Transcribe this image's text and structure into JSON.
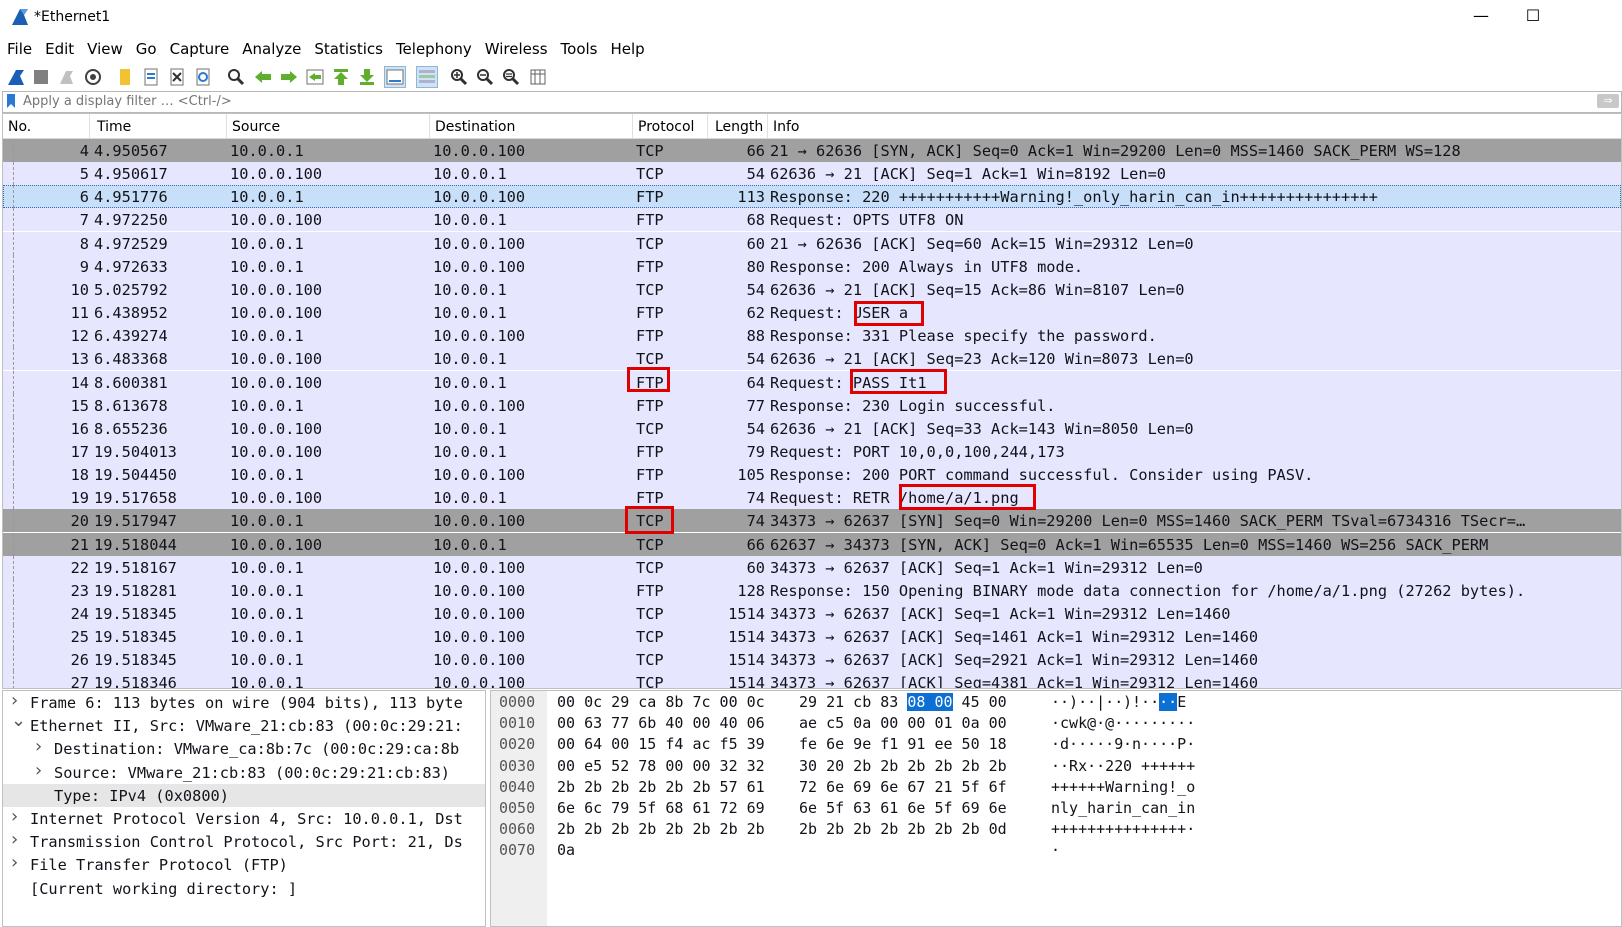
{
  "window": {
    "title": "*Ethernet1",
    "minimize": "—",
    "maximize": "☐"
  },
  "menu": [
    "File",
    "Edit",
    "View",
    "Go",
    "Capture",
    "Analyze",
    "Statistics",
    "Telephony",
    "Wireless",
    "Tools",
    "Help"
  ],
  "filter": {
    "placeholder": "Apply a display filter … <Ctrl-/>",
    "value": ""
  },
  "columns": [
    "No.",
    "Time",
    "Source",
    "Destination",
    "Protocol",
    "Length",
    "Info"
  ],
  "colors": {
    "tcp_row": "#e7e6ff",
    "selected_row": "#c7dff8",
    "dark_row": "#a0a0a0",
    "highlight": "#e00000"
  },
  "packets": [
    {
      "no": "4",
      "time": "4.950567",
      "src": "10.0.0.1",
      "dst": "10.0.0.100",
      "proto": "TCP",
      "len": "66",
      "info": "21 → 62636 [SYN, ACK] Seq=0 Ack=1 Win=29200 Len=0 MSS=1460 SACK_PERM WS=128",
      "style": "dark"
    },
    {
      "no": "5",
      "time": "4.950617",
      "src": "10.0.0.100",
      "dst": "10.0.0.1",
      "proto": "TCP",
      "len": "54",
      "info": "62636 → 21 [ACK] Seq=1 Ack=1 Win=8192 Len=0",
      "style": "tcp"
    },
    {
      "no": "6",
      "time": "4.951776",
      "src": "10.0.0.1",
      "dst": "10.0.0.100",
      "proto": "FTP",
      "len": "113",
      "info": "Response: 220 +++++++++++Warning!_only_harin_can_in+++++++++++++++",
      "style": "selected"
    },
    {
      "no": "7",
      "time": "4.972250",
      "src": "10.0.0.100",
      "dst": "10.0.0.1",
      "proto": "FTP",
      "len": "68",
      "info": "Request: OPTS UTF8 ON",
      "style": "tcp"
    },
    {
      "no": "8",
      "time": "4.972529",
      "src": "10.0.0.1",
      "dst": "10.0.0.100",
      "proto": "TCP",
      "len": "60",
      "info": "21 → 62636 [ACK] Seq=60 Ack=15 Win=29312 Len=0",
      "style": "tcp"
    },
    {
      "no": "9",
      "time": "4.972633",
      "src": "10.0.0.1",
      "dst": "10.0.0.100",
      "proto": "FTP",
      "len": "80",
      "info": "Response: 200 Always in UTF8 mode.",
      "style": "tcp"
    },
    {
      "no": "10",
      "time": "5.025792",
      "src": "10.0.0.100",
      "dst": "10.0.0.1",
      "proto": "TCP",
      "len": "54",
      "info": "62636 → 21 [ACK] Seq=15 Ack=86 Win=8107 Len=0",
      "style": "tcp"
    },
    {
      "no": "11",
      "time": "6.438952",
      "src": "10.0.0.100",
      "dst": "10.0.0.1",
      "proto": "FTP",
      "len": "62",
      "info": "Request: USER a",
      "style": "tcp"
    },
    {
      "no": "12",
      "time": "6.439274",
      "src": "10.0.0.1",
      "dst": "10.0.0.100",
      "proto": "FTP",
      "len": "88",
      "info": "Response: 331 Please specify the password.",
      "style": "tcp"
    },
    {
      "no": "13",
      "time": "6.483368",
      "src": "10.0.0.100",
      "dst": "10.0.0.1",
      "proto": "TCP",
      "len": "54",
      "info": "62636 → 21 [ACK] Seq=23 Ack=120 Win=8073 Len=0",
      "style": "tcp"
    },
    {
      "no": "14",
      "time": "8.600381",
      "src": "10.0.0.100",
      "dst": "10.0.0.1",
      "proto": "FTP",
      "len": "64",
      "info": "Request: PASS It1",
      "style": "tcp"
    },
    {
      "no": "15",
      "time": "8.613678",
      "src": "10.0.0.1",
      "dst": "10.0.0.100",
      "proto": "FTP",
      "len": "77",
      "info": "Response: 230 Login successful.",
      "style": "tcp"
    },
    {
      "no": "16",
      "time": "8.655236",
      "src": "10.0.0.100",
      "dst": "10.0.0.1",
      "proto": "TCP",
      "len": "54",
      "info": "62636 → 21 [ACK] Seq=33 Ack=143 Win=8050 Len=0",
      "style": "tcp"
    },
    {
      "no": "17",
      "time": "19.504013",
      "src": "10.0.0.100",
      "dst": "10.0.0.1",
      "proto": "FTP",
      "len": "79",
      "info": "Request: PORT 10,0,0,100,244,173",
      "style": "tcp"
    },
    {
      "no": "18",
      "time": "19.504450",
      "src": "10.0.0.1",
      "dst": "10.0.0.100",
      "proto": "FTP",
      "len": "105",
      "info": "Response: 200 PORT command successful. Consider using PASV.",
      "style": "tcp"
    },
    {
      "no": "19",
      "time": "19.517658",
      "src": "10.0.0.100",
      "dst": "10.0.0.1",
      "proto": "FTP",
      "len": "74",
      "info": "Request: RETR /home/a/1.png",
      "style": "tcp"
    },
    {
      "no": "20",
      "time": "19.517947",
      "src": "10.0.0.1",
      "dst": "10.0.0.100",
      "proto": "TCP",
      "len": "74",
      "info": "34373 → 62637 [SYN] Seq=0 Win=29200 Len=0 MSS=1460 SACK_PERM TSval=6734316 TSecr=…",
      "style": "dark"
    },
    {
      "no": "21",
      "time": "19.518044",
      "src": "10.0.0.100",
      "dst": "10.0.0.1",
      "proto": "TCP",
      "len": "66",
      "info": "62637 → 34373 [SYN, ACK] Seq=0 Ack=1 Win=65535 Len=0 MSS=1460 WS=256 SACK_PERM",
      "style": "dark"
    },
    {
      "no": "22",
      "time": "19.518167",
      "src": "10.0.0.1",
      "dst": "10.0.0.100",
      "proto": "TCP",
      "len": "60",
      "info": "34373 → 62637 [ACK] Seq=1 Ack=1 Win=29312 Len=0",
      "style": "tcp"
    },
    {
      "no": "23",
      "time": "19.518281",
      "src": "10.0.0.1",
      "dst": "10.0.0.100",
      "proto": "FTP",
      "len": "128",
      "info": "Response: 150 Opening BINARY mode data connection for /home/a/1.png (27262 bytes).",
      "style": "tcp"
    },
    {
      "no": "24",
      "time": "19.518345",
      "src": "10.0.0.1",
      "dst": "10.0.0.100",
      "proto": "TCP",
      "len": "1514",
      "info": "34373 → 62637 [ACK] Seq=1 Ack=1 Win=29312 Len=1460",
      "style": "tcp"
    },
    {
      "no": "25",
      "time": "19.518345",
      "src": "10.0.0.1",
      "dst": "10.0.0.100",
      "proto": "TCP",
      "len": "1514",
      "info": "34373 → 62637 [ACK] Seq=1461 Ack=1 Win=29312 Len=1460",
      "style": "tcp"
    },
    {
      "no": "26",
      "time": "19.518345",
      "src": "10.0.0.1",
      "dst": "10.0.0.100",
      "proto": "TCP",
      "len": "1514",
      "info": "34373 → 62637 [ACK] Seq=2921 Ack=1 Win=29312 Len=1460",
      "style": "tcp"
    },
    {
      "no": "27",
      "time": "19.518346",
      "src": "10.0.0.1",
      "dst": "10.0.0.100",
      "proto": "TCP",
      "len": "1514",
      "info": "34373 → 62637 [ACK] Seq=4381 Ack=1 Win=29312 Len=1460",
      "style": "tcp"
    }
  ],
  "details": [
    {
      "twisty": ">",
      "indent": 0,
      "text": "Frame 6: 113 bytes on wire (904 bits), 113 byte",
      "selected": false
    },
    {
      "twisty": "v",
      "indent": 0,
      "text": "Ethernet II, Src: VMware_21:cb:83 (00:0c:29:21:",
      "selected": false
    },
    {
      "twisty": ">",
      "indent": 1,
      "text": "Destination: VMware_ca:8b:7c (00:0c:29:ca:8b",
      "selected": false
    },
    {
      "twisty": ">",
      "indent": 1,
      "text": "Source: VMware_21:cb:83 (00:0c:29:21:cb:83)",
      "selected": false
    },
    {
      "twisty": "",
      "indent": 1,
      "text": "Type: IPv4 (0x0800)",
      "selected": true
    },
    {
      "twisty": ">",
      "indent": 0,
      "text": "Internet Protocol Version 4, Src: 10.0.0.1, Dst",
      "selected": false
    },
    {
      "twisty": ">",
      "indent": 0,
      "text": "Transmission Control Protocol, Src Port: 21, Ds",
      "selected": false
    },
    {
      "twisty": ">",
      "indent": 0,
      "text": "File Transfer Protocol (FTP)",
      "selected": false
    },
    {
      "twisty": "",
      "indent": 0,
      "text": "[Current working directory: ]",
      "selected": false
    }
  ],
  "bytes": [
    {
      "off": "0000",
      "hex1": "00 0c 29 ca 8b 7c 00 0c",
      "hex2a": "29 21 cb 83 ",
      "hex2hl": "08 00",
      "hex2b": " 45 00",
      "asc1": "··)··|··",
      "asc2a": " )!··",
      "asc2hl": "··",
      "asc2b": "E"
    },
    {
      "off": "0010",
      "hex1": "00 63 77 6b 40 00 40 06",
      "hex2a": "ae c5 0a 00 00 01 0a 00",
      "hex2hl": "",
      "hex2b": "",
      "asc1": "·cwk@·@·",
      "asc2a": " ········",
      "asc2hl": "",
      "asc2b": ""
    },
    {
      "off": "0020",
      "hex1": "00 64 00 15 f4 ac f5 39",
      "hex2a": "fe 6e 9e f1 91 ee 50 18",
      "hex2hl": "",
      "hex2b": "",
      "asc1": "·d·····9",
      "asc2a": " ·n····P·",
      "asc2hl": "",
      "asc2b": ""
    },
    {
      "off": "0030",
      "hex1": "00 e5 52 78 00 00 32 32",
      "hex2a": "30 20 2b 2b 2b 2b 2b 2b",
      "hex2hl": "",
      "hex2b": "",
      "asc1": "··Rx··22",
      "asc2a": " 0 ++++++",
      "asc2hl": "",
      "asc2b": ""
    },
    {
      "off": "0040",
      "hex1": "2b 2b 2b 2b 2b 2b 57 61",
      "hex2a": "72 6e 69 6e 67 21 5f 6f",
      "hex2hl": "",
      "hex2b": "",
      "asc1": "++++++Wa",
      "asc2a": " rning!_o",
      "asc2hl": "",
      "asc2b": ""
    },
    {
      "off": "0050",
      "hex1": "6e 6c 79 5f 68 61 72 69",
      "hex2a": "6e 5f 63 61 6e 5f 69 6e",
      "hex2hl": "",
      "hex2b": "",
      "asc1": "nly_hari",
      "asc2a": " n_can_in",
      "asc2hl": "",
      "asc2b": ""
    },
    {
      "off": "0060",
      "hex1": "2b 2b 2b 2b 2b 2b 2b 2b",
      "hex2a": "2b 2b 2b 2b 2b 2b 2b 0d",
      "hex2hl": "",
      "hex2b": "",
      "asc1": "++++++++",
      "asc2a": " +++++++·",
      "asc2hl": "",
      "asc2b": ""
    },
    {
      "off": "0070",
      "hex1": "0a",
      "hex2a": "",
      "hex2hl": "",
      "hex2b": "",
      "asc1": "·",
      "asc2a": "",
      "asc2hl": "",
      "asc2b": ""
    }
  ],
  "toolbar_icons": [
    "shark-fin-start-icon",
    "stop-capture-icon",
    "restart-capture-icon",
    "capture-options-icon",
    "open-file-icon",
    "save-file-icon",
    "close-file-icon",
    "reload-file-icon",
    "find-packet-icon",
    "go-back-icon",
    "go-forward-icon",
    "go-to-packet-icon",
    "go-first-icon",
    "go-last-icon",
    "autoscroll-icon",
    "colorize-icon",
    "zoom-in-icon",
    "zoom-out-icon",
    "zoom-normal-icon",
    "resize-columns-icon"
  ]
}
